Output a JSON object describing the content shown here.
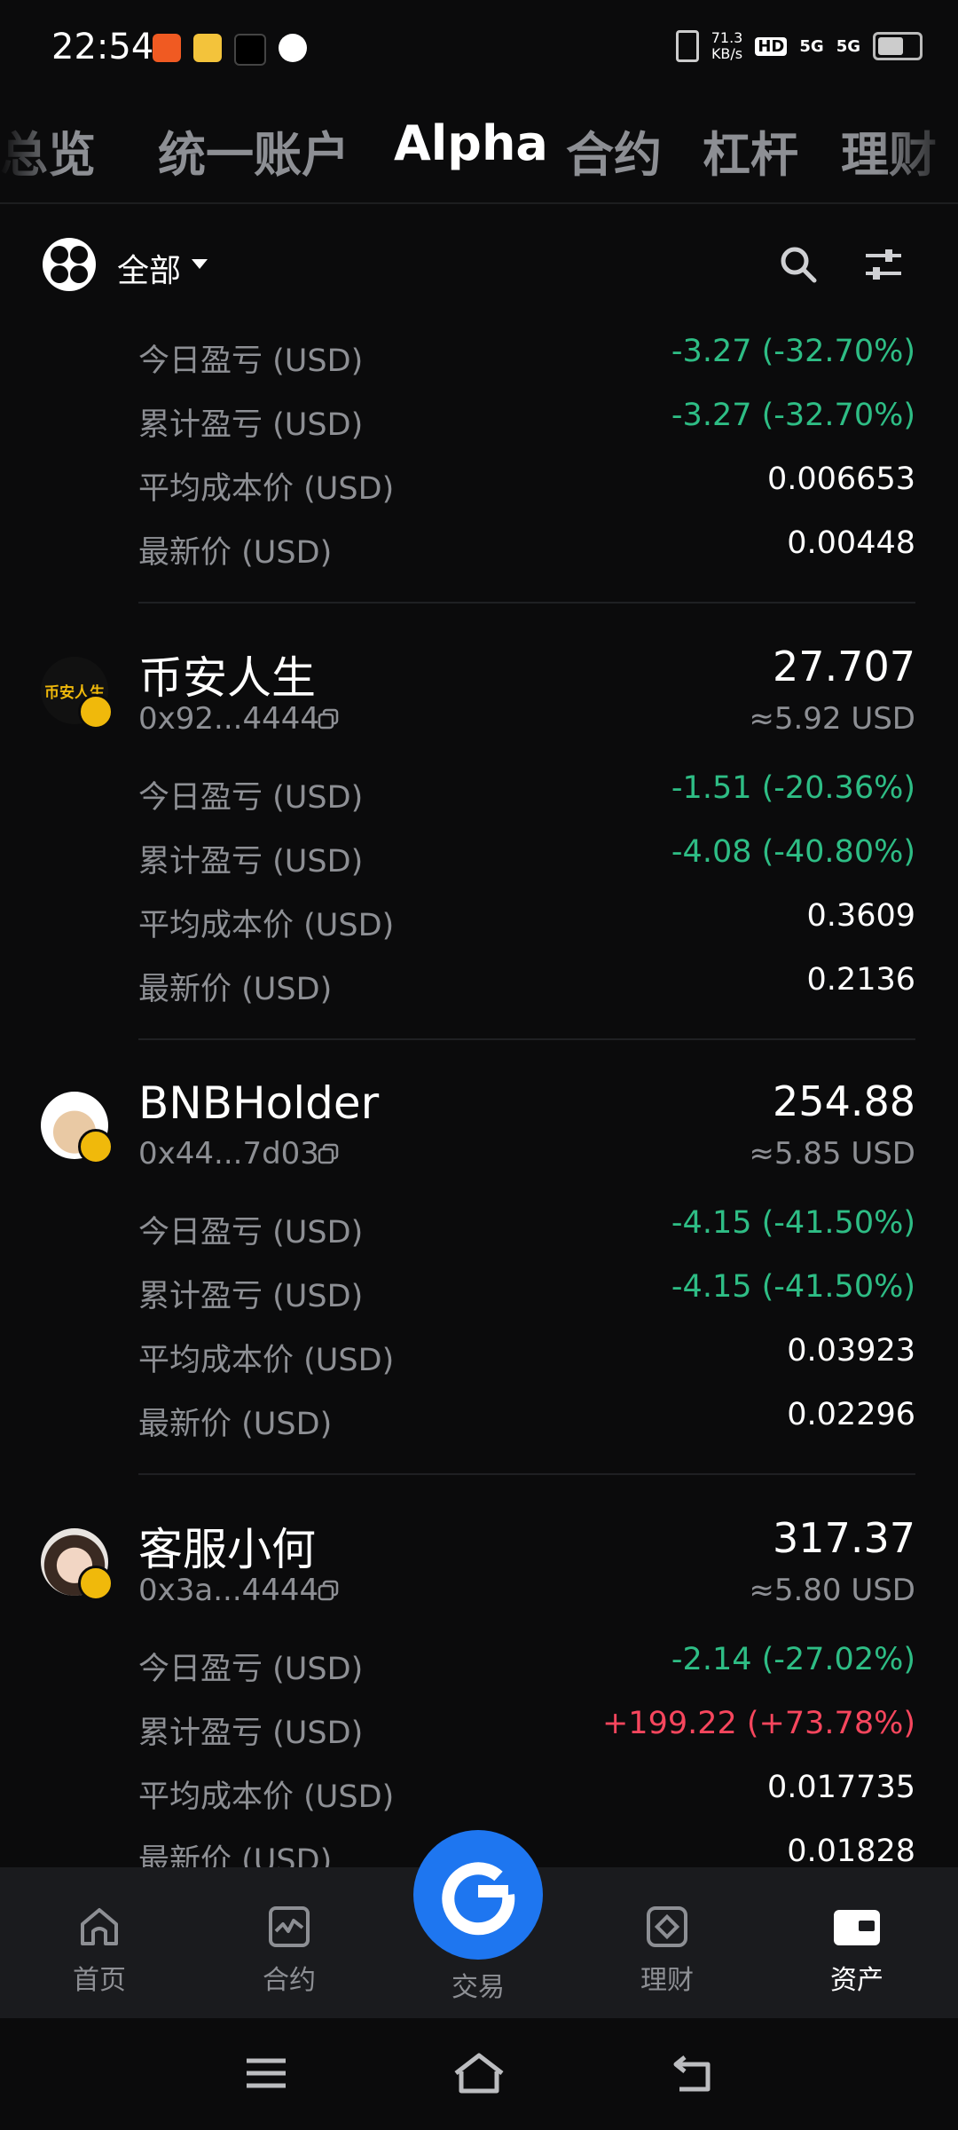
{
  "status_bar": {
    "time": "22:54",
    "net_speed": "71.3",
    "net_unit": "KB/s",
    "hd": "HD",
    "signal1": "5G",
    "signal2": "5G"
  },
  "tabs": [
    {
      "label": "总览"
    },
    {
      "label": "统一账户"
    },
    {
      "label": "Alpha"
    },
    {
      "label": "合约"
    },
    {
      "label": "杠杆"
    },
    {
      "label": "理财"
    }
  ],
  "filter": {
    "label": "全部"
  },
  "partial_asset": {
    "rows": [
      {
        "label": "今日盈亏 (USD)",
        "value": "-3.27 (-32.70%)"
      },
      {
        "label": "累计盈亏 (USD)",
        "value": "-3.27 (-32.70%)"
      },
      {
        "label": "平均成本价 (USD)",
        "value": "0.006653"
      },
      {
        "label": "最新价 (USD)",
        "value": "0.00448"
      }
    ]
  },
  "assets": [
    {
      "name": "币安人生",
      "avatar_text": "币安人生",
      "address": "0x92...4444",
      "amount": "27.707",
      "usd": "≈5.92 USD",
      "rows": [
        {
          "label": "今日盈亏 (USD)",
          "value": "-1.51 (-20.36%)"
        },
        {
          "label": "累计盈亏 (USD)",
          "value": "-4.08 (-40.80%)"
        },
        {
          "label": "平均成本价 (USD)",
          "value": "0.3609"
        },
        {
          "label": "最新价 (USD)",
          "value": "0.2136"
        }
      ]
    },
    {
      "name": "BNBHolder",
      "address": "0x44...7d03",
      "amount": "254.88",
      "usd": "≈5.85 USD",
      "rows": [
        {
          "label": "今日盈亏 (USD)",
          "value": "-4.15 (-41.50%)"
        },
        {
          "label": "累计盈亏 (USD)",
          "value": "-4.15 (-41.50%)"
        },
        {
          "label": "平均成本价 (USD)",
          "value": "0.03923"
        },
        {
          "label": "最新价 (USD)",
          "value": "0.02296"
        }
      ]
    },
    {
      "name": "客服小何",
      "address": "0x3a...4444",
      "amount": "317.37",
      "usd": "≈5.80 USD",
      "rows": [
        {
          "label": "今日盈亏 (USD)",
          "value": "-2.14 (-27.02%)"
        },
        {
          "label": "累计盈亏 (USD)",
          "value": "+199.22 (+73.78%)"
        },
        {
          "label": "平均成本价 (USD)",
          "value": "0.017735"
        },
        {
          "label": "最新价 (USD)",
          "value": "0.01828"
        }
      ]
    }
  ],
  "bottom_nav": [
    {
      "label": "首页",
      "icon": "home-icon"
    },
    {
      "label": "合约",
      "icon": "futures-icon"
    },
    {
      "label": "交易",
      "icon": "trade-icon"
    },
    {
      "label": "理财",
      "icon": "earn-icon"
    },
    {
      "label": "资产",
      "icon": "wallet-icon"
    }
  ],
  "colors": {
    "background": "#0b0b0c",
    "gain": "#2ebd85",
    "loss": "#f6465d",
    "accent": "#1e76f0",
    "muted": "#8d8f94"
  }
}
